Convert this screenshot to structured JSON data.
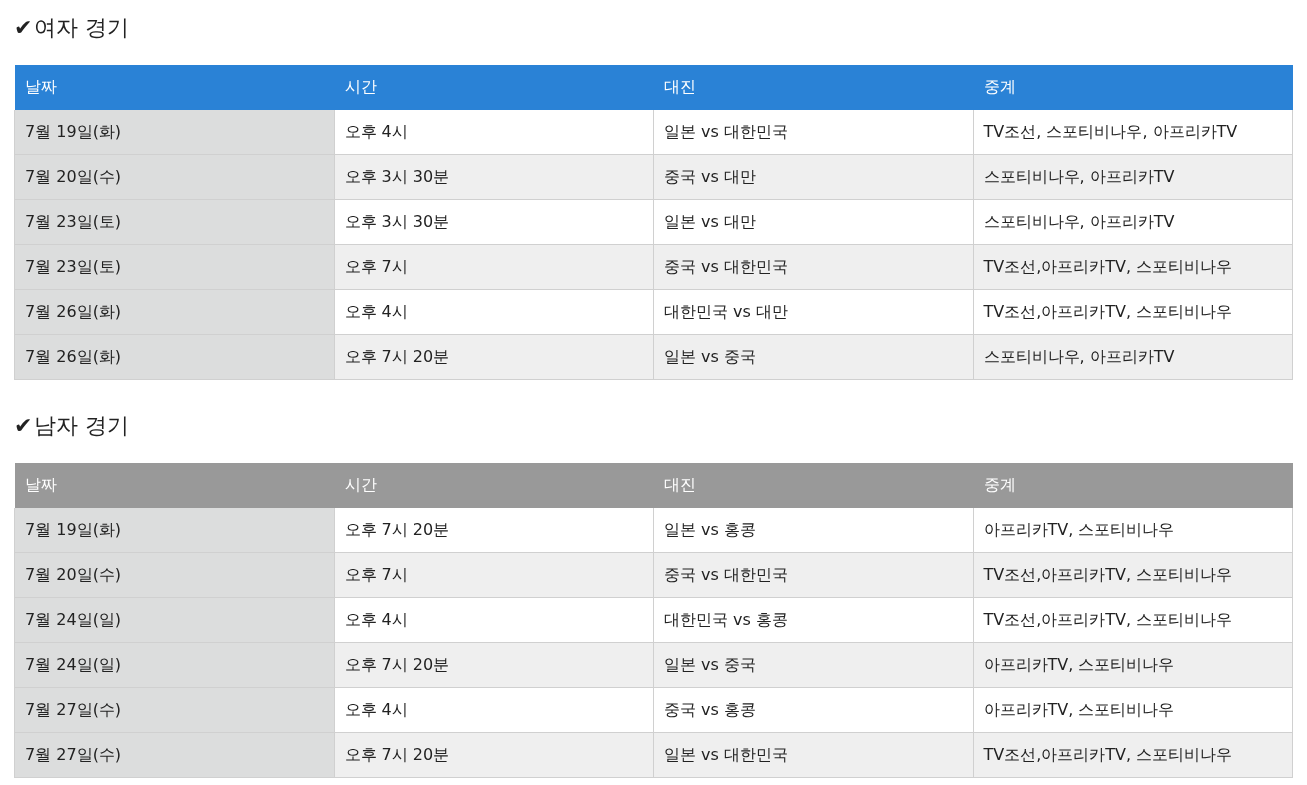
{
  "sections": [
    {
      "mark": "✔",
      "title": "여자 경기",
      "color": "#2a82d6",
      "columns": [
        "날짜",
        "시간",
        "대진",
        "중계"
      ],
      "rows": [
        [
          "7월 19일(화)",
          "오후 4시",
          "일본 vs 대한민국",
          "TV조선, 스포티비나우, 아프리카TV"
        ],
        [
          "7월 20일(수)",
          "오후 3시 30분",
          "중국 vs 대만",
          "스포티비나우, 아프리카TV"
        ],
        [
          "7월 23일(토)",
          "오후 3시 30분",
          "일본 vs 대만",
          "스포티비나우, 아프리카TV"
        ],
        [
          "7월 23일(토)",
          "오후 7시",
          "중국 vs 대한민국",
          "TV조선,아프리카TV, 스포티비나우"
        ],
        [
          "7월 26일(화)",
          "오후 4시",
          "대한민국 vs 대만",
          "TV조선,아프리카TV, 스포티비나우"
        ],
        [
          "7월 26일(화)",
          "오후 7시 20분",
          "일본 vs 중국",
          "스포티비나우, 아프리카TV"
        ]
      ]
    },
    {
      "mark": "✔",
      "title": "남자 경기",
      "color": "#999999",
      "columns": [
        "날짜",
        "시간",
        "대진",
        "중계"
      ],
      "rows": [
        [
          "7월 19일(화)",
          "오후 7시 20분",
          "일본 vs 홍콩",
          "아프리카TV, 스포티비나우"
        ],
        [
          "7월 20일(수)",
          "오후 7시",
          "중국 vs 대한민국",
          "TV조선,아프리카TV, 스포티비나우"
        ],
        [
          "7월 24일(일)",
          "오후 4시",
          "대한민국 vs 홍콩",
          "TV조선,아프리카TV, 스포티비나우"
        ],
        [
          "7월 24일(일)",
          "오후 7시 20분",
          "일본 vs 중국",
          "아프리카TV, 스포티비나우"
        ],
        [
          "7월 27일(수)",
          "오후 4시",
          "중국 vs 홍콩",
          "아프리카TV, 스포티비나우"
        ],
        [
          "7월 27일(수)",
          "오후 7시 20분",
          "일본 vs 대한민국",
          "TV조선,아프리카TV, 스포티비나우"
        ]
      ]
    }
  ]
}
